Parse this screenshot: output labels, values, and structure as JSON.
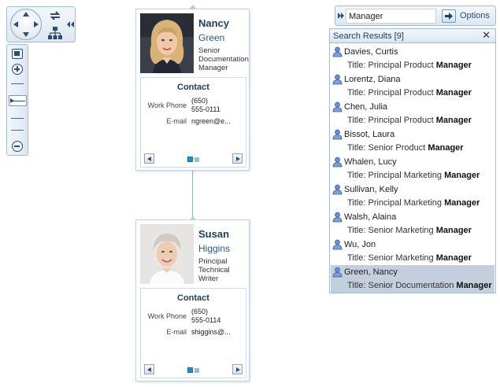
{
  "navigator": {
    "icons": [
      "pan-up-icon",
      "pan-down-icon",
      "pan-left-icon",
      "pan-right-icon",
      "rotate-layout-icon",
      "hierarchy-icon",
      "collapse-left-icon",
      "zoom-fit-icon",
      "zoom-in-icon",
      "zoom-out-icon"
    ],
    "zoom_level_fraction": 0.55
  },
  "employees": [
    {
      "first_name": "Nancy",
      "last_name": "Green",
      "title_lines": [
        "Senior",
        "Documentation",
        "Manager"
      ],
      "contact_heading": "Contact",
      "work_phone_label": "Work Phone",
      "work_phone_lines": [
        "(650)",
        "555-0111"
      ],
      "email_label": "E-mail",
      "email_value": "ngreen@e..."
    },
    {
      "first_name": "Susan",
      "last_name": "Higgins",
      "title_lines": [
        "Principal",
        "Technical",
        "Writer"
      ],
      "contact_heading": "Contact",
      "work_phone_label": "Work Phone",
      "work_phone_lines": [
        "(650)",
        "555-0114"
      ],
      "email_label": "E-mail",
      "email_value": "shiggins@..."
    }
  ],
  "search": {
    "query": "Manager",
    "options_label": "Options",
    "results_title": "Search Results [9]",
    "close_glyph": "✕",
    "title_prefix": "Title:",
    "results": [
      {
        "name": "Davies, Curtis",
        "title_pre": "Principal Product",
        "title_match": "Manager",
        "selected": false
      },
      {
        "name": "Lorentz, Diana",
        "title_pre": "Principal Product",
        "title_match": "Manager",
        "selected": false
      },
      {
        "name": "Chen, Julia",
        "title_pre": "Principal Product",
        "title_match": "Manager",
        "selected": false
      },
      {
        "name": "Bissot, Laura",
        "title_pre": "Senior Product",
        "title_match": "Manager",
        "selected": false
      },
      {
        "name": "Whalen, Lucy",
        "title_pre": "Principal Marketing",
        "title_match": "Manager",
        "selected": false
      },
      {
        "name": "Sullivan, Kelly",
        "title_pre": "Principal Marketing",
        "title_match": "Manager",
        "selected": false
      },
      {
        "name": "Walsh, Alaina",
        "title_pre": "Senior Marketing",
        "title_match": "Manager",
        "selected": false
      },
      {
        "name": "Wu, Jon",
        "title_pre": "Senior Marketing",
        "title_match": "Manager",
        "selected": false
      },
      {
        "name": "Green, Nancy",
        "title_pre": "Senior Documentation",
        "title_match": "Manager",
        "selected": true
      }
    ]
  },
  "colors": {
    "accent": "#1b3f63",
    "selection": "#c3cfdd",
    "pager_active": "#1f8fd6"
  }
}
